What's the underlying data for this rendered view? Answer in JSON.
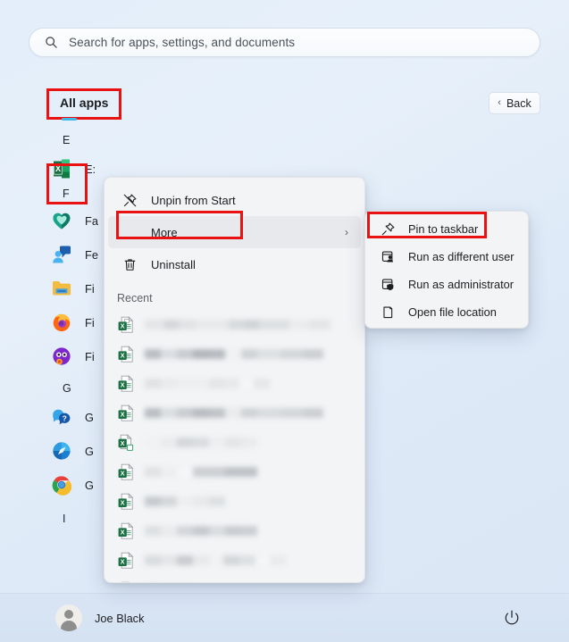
{
  "search": {
    "placeholder": "Search for apps, settings, and documents",
    "icon": "search-icon"
  },
  "header": {
    "all_apps_label": "All apps",
    "back_label": "Back",
    "back_icon": "chevron-left-icon"
  },
  "app_list": {
    "sections": [
      {
        "letter": "E",
        "apps": [
          {
            "name": "E:",
            "icon": "excel-icon",
            "highlighted": true
          }
        ]
      },
      {
        "letter": "F",
        "apps": [
          {
            "name": "Fa",
            "icon": "family-safety-icon",
            "highlighted": false
          },
          {
            "name": "Fe",
            "icon": "feedback-hub-icon",
            "highlighted": false
          },
          {
            "name": "Fi",
            "icon": "file-explorer-icon",
            "highlighted": false
          },
          {
            "name": "Fi",
            "icon": "firefox-icon",
            "highlighted": false
          },
          {
            "name": "Fi",
            "icon": "firefox-nightly-icon",
            "highlighted": false
          }
        ]
      },
      {
        "letter": "G",
        "apps": [
          {
            "name": "G",
            "icon": "get-help-icon",
            "highlighted": false
          },
          {
            "name": "G",
            "icon": "get-started-icon",
            "highlighted": false
          },
          {
            "name": "G",
            "icon": "google-chrome-icon",
            "highlighted": false
          }
        ]
      },
      {
        "letter": "I",
        "apps": []
      }
    ]
  },
  "context_menu": {
    "items": [
      {
        "label": "Unpin from Start",
        "icon": "unpin-icon",
        "has_submenu": false,
        "hovered": false,
        "highlighted": false
      },
      {
        "label": "More",
        "icon": "",
        "has_submenu": true,
        "hovered": true,
        "highlighted": true,
        "arrow": "›"
      },
      {
        "label": "Uninstall",
        "icon": "trash-icon",
        "has_submenu": false,
        "hovered": false,
        "highlighted": false
      }
    ],
    "recent_label": "Recent",
    "recent_items": [
      {
        "icon": "excel-doc-icon",
        "redacted": true
      },
      {
        "icon": "excel-doc-icon",
        "redacted": true
      },
      {
        "icon": "excel-doc-icon",
        "redacted": true
      },
      {
        "icon": "excel-doc-icon",
        "redacted": true
      },
      {
        "icon": "excel-doc-copy-icon",
        "redacted": true
      },
      {
        "icon": "excel-doc-icon",
        "redacted": true
      },
      {
        "icon": "excel-doc-icon",
        "redacted": true
      },
      {
        "icon": "excel-doc-icon",
        "redacted": true
      },
      {
        "icon": "excel-doc-icon",
        "redacted": true
      },
      {
        "icon": "excel-sheet-icon",
        "redacted": true
      }
    ]
  },
  "submenu": {
    "items": [
      {
        "label": "Pin to taskbar",
        "icon": "pin-icon",
        "highlighted": true
      },
      {
        "label": "Run as different user",
        "icon": "run-as-user-icon",
        "highlighted": false
      },
      {
        "label": "Run as administrator",
        "icon": "run-as-admin-icon",
        "highlighted": false
      },
      {
        "label": "Open file location",
        "icon": "folder-open-icon",
        "highlighted": false
      }
    ]
  },
  "footer": {
    "user_name": "Joe Black",
    "avatar_icon": "avatar-icon",
    "power_icon": "power-icon"
  },
  "colors": {
    "highlight_red": "#e81212",
    "excel_green": "#1d7044",
    "accent_blue": "#3fb8e8"
  }
}
